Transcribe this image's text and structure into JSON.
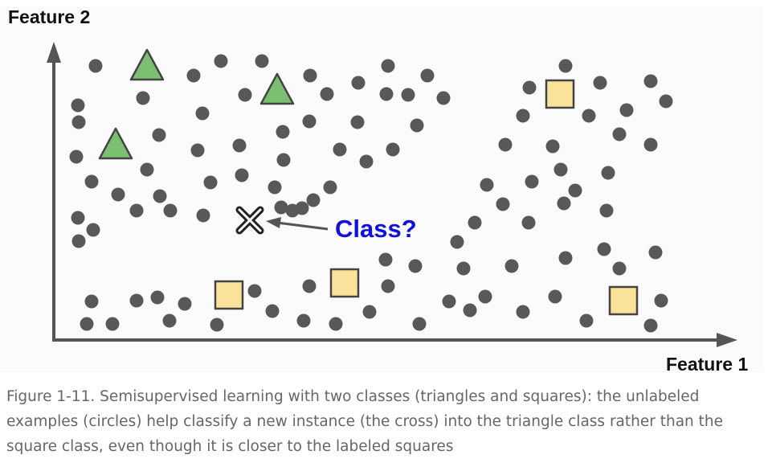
{
  "figure": {
    "y_axis_label": "Feature 2",
    "x_axis_label": "Feature 1",
    "query_label": "Class?",
    "colors": {
      "axis": "#555555",
      "unlabeled": "#585858",
      "triangle_fill": "#7dbf72",
      "square_fill": "#fbe29a",
      "shape_stroke": "#444444",
      "query_text": "#1111dd",
      "cross": "#222222"
    },
    "icons": [
      "unlabeled-point",
      "triangle-labeled-point",
      "square-labeled-point",
      "cross-new-instance",
      "arrow"
    ]
  },
  "caption": "Figure 1-11. Semisupervised learning with two classes (triangles and squares): the unlabeled examples (circles) help classify a new instance (the cross) into the triangle class rather than the square class, even though it is closer to the labeled squares"
}
